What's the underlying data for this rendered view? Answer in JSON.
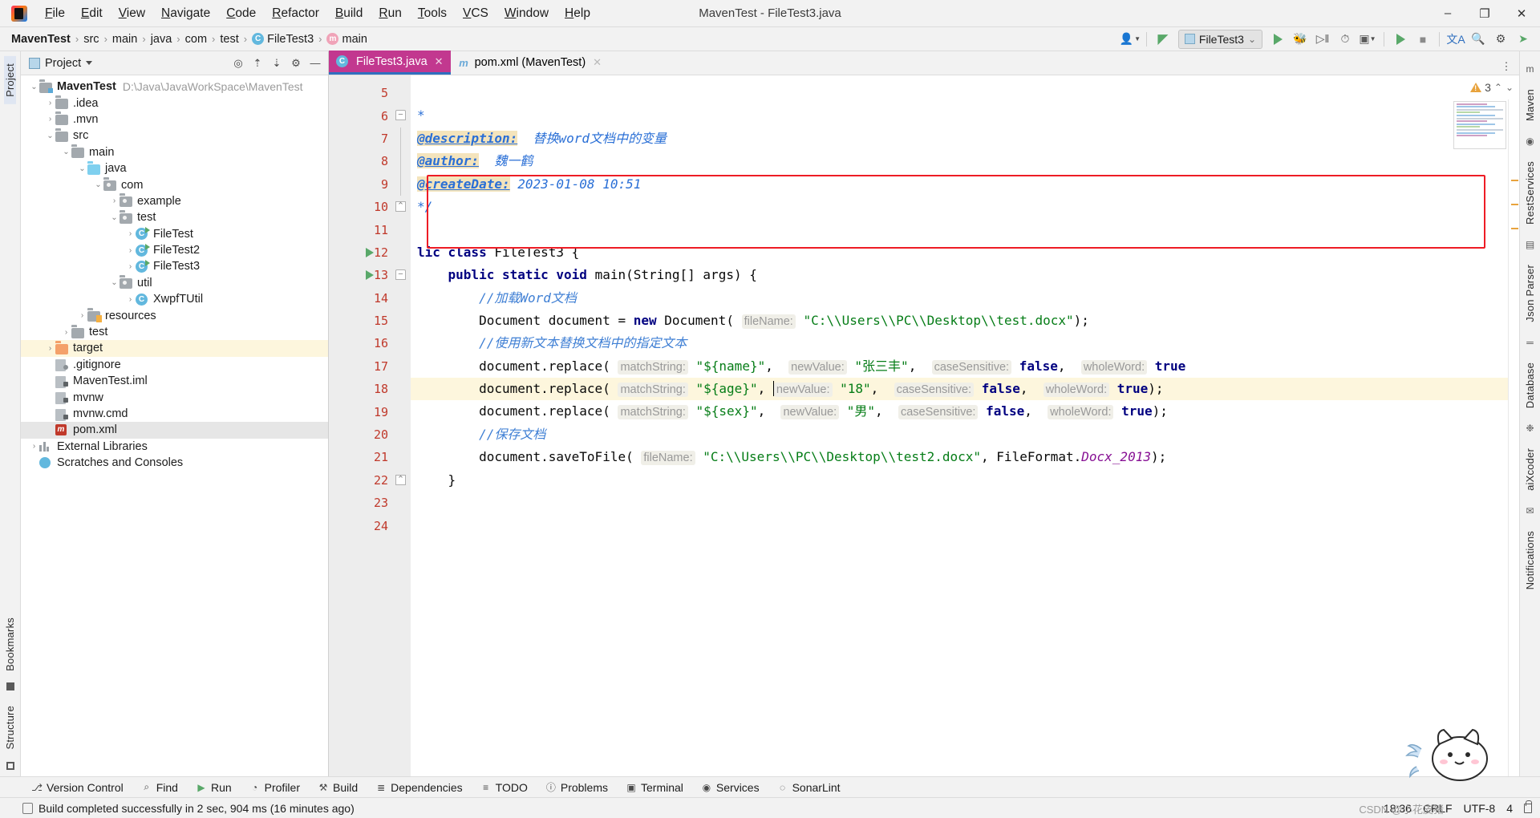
{
  "window": {
    "title": "MavenTest - FileTest3.java",
    "minimize": "–",
    "maximize": "❐",
    "close": "✕"
  },
  "menu": {
    "items": [
      "File",
      "Edit",
      "View",
      "Navigate",
      "Code",
      "Refactor",
      "Build",
      "Run",
      "Tools",
      "VCS",
      "Window",
      "Help"
    ]
  },
  "breadcrumb": {
    "items": [
      {
        "label": "MavenTest",
        "icon": "",
        "bold": true
      },
      {
        "label": "src",
        "icon": "",
        "bold": false
      },
      {
        "label": "main",
        "icon": "",
        "bold": false
      },
      {
        "label": "java",
        "icon": "",
        "bold": false
      },
      {
        "label": "com",
        "icon": "",
        "bold": false
      },
      {
        "label": "test",
        "icon": "",
        "bold": false
      },
      {
        "label": "FileTest3",
        "icon": "class-icon",
        "bold": false
      },
      {
        "label": "main",
        "icon": "method-icon",
        "bold": false
      }
    ],
    "separator": "›"
  },
  "toolbar": {
    "run_config": "FileTest3",
    "search_icon": "search-icon",
    "settings_icon": "gear-icon",
    "translate_icon": "translate-icon",
    "user_icon": "user-icon",
    "hammer_icon": "build-icon",
    "run_icon": "run-icon",
    "debug_icon": "debug-icon",
    "coverage_icon": "coverage-icon",
    "profile_icon": "profile-icon",
    "stop_icon": "stop-icon",
    "updates_icon": "updates-icon"
  },
  "project_panel": {
    "title": "Project",
    "actions": [
      "target-icon",
      "collapse-icon",
      "expand-icon",
      "gear-icon",
      "minimize-icon"
    ],
    "tree": [
      {
        "depth": 0,
        "arrow": "⌄",
        "icon": "module-folder",
        "label": "MavenTest",
        "bold": true,
        "path": "D:\\Java\\JavaWorkSpace\\MavenTest",
        "state": "normal"
      },
      {
        "depth": 1,
        "arrow": "›",
        "icon": "folder",
        "label": ".idea",
        "bold": false,
        "path": "",
        "state": "normal"
      },
      {
        "depth": 1,
        "arrow": "›",
        "icon": "folder",
        "label": ".mvn",
        "bold": false,
        "path": "",
        "state": "normal"
      },
      {
        "depth": 1,
        "arrow": "⌄",
        "icon": "folder",
        "label": "src",
        "bold": false,
        "path": "",
        "state": "normal"
      },
      {
        "depth": 2,
        "arrow": "⌄",
        "icon": "folder",
        "label": "main",
        "bold": false,
        "path": "",
        "state": "normal"
      },
      {
        "depth": 3,
        "arrow": "⌄",
        "icon": "source-folder",
        "label": "java",
        "bold": false,
        "path": "",
        "state": "normal"
      },
      {
        "depth": 4,
        "arrow": "⌄",
        "icon": "package",
        "label": "com",
        "bold": false,
        "path": "",
        "state": "normal"
      },
      {
        "depth": 5,
        "arrow": "›",
        "icon": "package",
        "label": "example",
        "bold": false,
        "path": "",
        "state": "normal"
      },
      {
        "depth": 5,
        "arrow": "⌄",
        "icon": "package",
        "label": "test",
        "bold": false,
        "path": "",
        "state": "normal"
      },
      {
        "depth": 6,
        "arrow": "›",
        "icon": "class-runnable",
        "label": "FileTest",
        "bold": false,
        "path": "",
        "state": "normal"
      },
      {
        "depth": 6,
        "arrow": "›",
        "icon": "class-runnable",
        "label": "FileTest2",
        "bold": false,
        "path": "",
        "state": "normal"
      },
      {
        "depth": 6,
        "arrow": "›",
        "icon": "class-runnable",
        "label": "FileTest3",
        "bold": false,
        "path": "",
        "state": "normal"
      },
      {
        "depth": 5,
        "arrow": "⌄",
        "icon": "package",
        "label": "util",
        "bold": false,
        "path": "",
        "state": "normal"
      },
      {
        "depth": 6,
        "arrow": "›",
        "icon": "class",
        "label": "XwpfTUtil",
        "bold": false,
        "path": "",
        "state": "normal"
      },
      {
        "depth": 3,
        "arrow": "›",
        "icon": "resource-folder",
        "label": "resources",
        "bold": false,
        "path": "",
        "state": "normal"
      },
      {
        "depth": 2,
        "arrow": "›",
        "icon": "folder",
        "label": "test",
        "bold": false,
        "path": "",
        "state": "normal"
      },
      {
        "depth": 1,
        "arrow": "›",
        "icon": "target-folder",
        "label": "target",
        "bold": false,
        "path": "",
        "state": "highlight"
      },
      {
        "depth": 1,
        "arrow": "",
        "icon": "gitignore-file",
        "label": ".gitignore",
        "bold": false,
        "path": "",
        "state": "normal"
      },
      {
        "depth": 1,
        "arrow": "",
        "icon": "iml-file",
        "label": "MavenTest.iml",
        "bold": false,
        "path": "",
        "state": "normal"
      },
      {
        "depth": 1,
        "arrow": "",
        "icon": "file",
        "label": "mvnw",
        "bold": false,
        "path": "",
        "state": "normal"
      },
      {
        "depth": 1,
        "arrow": "",
        "icon": "file",
        "label": "mvnw.cmd",
        "bold": false,
        "path": "",
        "state": "normal"
      },
      {
        "depth": 1,
        "arrow": "",
        "icon": "maven-file",
        "label": "pom.xml",
        "bold": false,
        "path": "",
        "state": "selected"
      },
      {
        "depth": 0,
        "arrow": "›",
        "icon": "library",
        "label": "External Libraries",
        "bold": false,
        "path": "",
        "state": "normal"
      },
      {
        "depth": 0,
        "arrow": "",
        "icon": "scratch",
        "label": "Scratches and Consoles",
        "bold": false,
        "path": "",
        "state": "normal"
      }
    ]
  },
  "left_strip": {
    "items": [
      "Project",
      "Bookmarks",
      "Structure"
    ]
  },
  "right_strip": {
    "items": [
      "Maven",
      "RestServices",
      "Json Parser",
      "Database",
      "aiXcoder",
      "Notifications"
    ]
  },
  "editor": {
    "tabs": [
      {
        "label": "FileTest3.java",
        "icon": "class-icon",
        "active": true
      },
      {
        "label": "pom.xml (MavenTest)",
        "icon": "maven-icon",
        "active": false
      }
    ],
    "warning_count": "3",
    "lines": [
      {
        "no": "5",
        "fold": "",
        "run": false,
        "hl": false,
        "html": ""
      },
      {
        "no": "6",
        "fold": "minus",
        "run": false,
        "hl": false,
        "html": "<span class=\"jd\">*</span>"
      },
      {
        "no": "7",
        "fold": "bar",
        "run": false,
        "hl": false,
        "html": "<span class=\"jdtag\">@description:</span><span class=\"jd\">  替换word文档中的变量</span>"
      },
      {
        "no": "8",
        "fold": "bar",
        "run": false,
        "hl": false,
        "html": "<span class=\"jdtag\">@author:</span><span class=\"jd\">  魏一鹤</span>"
      },
      {
        "no": "9",
        "fold": "bar",
        "run": false,
        "hl": false,
        "html": "<span class=\"jdtag\">@createDate:</span><span class=\"jd\"> 2023-01-08 10:51</span>"
      },
      {
        "no": "10",
        "fold": "end",
        "run": false,
        "hl": false,
        "html": "<span class=\"jd\">*/</span>"
      },
      {
        "no": "11",
        "fold": "",
        "run": false,
        "hl": false,
        "html": ""
      },
      {
        "no": "12",
        "fold": "",
        "run": true,
        "hl": false,
        "html": "<span class=\"kw\">lic class </span><span class=\"plain\">FileTest3 </span><span class=\"plain\">{</span>"
      },
      {
        "no": "13",
        "fold": "minus",
        "run": true,
        "hl": false,
        "html": "    <span class=\"kw\">public static void </span><span class=\"plain\">main(String[] args) {</span>"
      },
      {
        "no": "14",
        "fold": "",
        "run": false,
        "hl": false,
        "html": "        <span class=\"cmt\">//加载Word文档</span>"
      },
      {
        "no": "15",
        "fold": "",
        "run": false,
        "hl": false,
        "html": "        <span class=\"plain\">Document document = </span><span class=\"kw\">new </span><span class=\"plain\">Document(</span> <span class=\"hint\">fileName:</span> <span class=\"str\">\"C:\\\\Users\\\\PC\\\\Desktop\\\\test.docx\"</span><span class=\"plain\">);</span>"
      },
      {
        "no": "16",
        "fold": "",
        "run": false,
        "hl": false,
        "html": "        <span class=\"cmt\">//使用新文本替换文档中的指定文本</span>"
      },
      {
        "no": "17",
        "fold": "",
        "run": false,
        "hl": false,
        "html": "        <span class=\"plain\">document.replace(</span> <span class=\"hint\">matchString:</span> <span class=\"str\">\"${name}\"</span><span class=\"plain\">,</span>  <span class=\"hint\">newValue:</span> <span class=\"str\">\"张三丰\"</span><span class=\"plain\">,</span>  <span class=\"hint\">caseSensitive:</span> <span class=\"kw\">false</span><span class=\"plain\">,</span>  <span class=\"hint\">wholeWord:</span> <span class=\"kw\">true</span>"
      },
      {
        "no": "18",
        "fold": "",
        "run": false,
        "hl": true,
        "html": "        <span class=\"plain\">document.replace(</span> <span class=\"hint\">matchString:</span> <span class=\"str\">\"${age}\"</span><span class=\"plain\">,</span> <span class=\"caret\"></span><span class=\"hint\">newValue:</span> <span class=\"str\">\"18\"</span><span class=\"plain\">,</span>  <span class=\"hint\">caseSensitive:</span> <span class=\"kw\">false</span><span class=\"plain\">,</span>  <span class=\"hint\">wholeWord:</span> <span class=\"kw\">true</span><span class=\"plain\">);</span>"
      },
      {
        "no": "19",
        "fold": "",
        "run": false,
        "hl": false,
        "html": "        <span class=\"plain\">document.replace(</span> <span class=\"hint\">matchString:</span> <span class=\"str\">\"${sex}\"</span><span class=\"plain\">,</span>  <span class=\"hint\">newValue:</span> <span class=\"str\">\"男\"</span><span class=\"plain\">,</span>  <span class=\"hint\">caseSensitive:</span> <span class=\"kw\">false</span><span class=\"plain\">,</span>  <span class=\"hint\">wholeWord:</span> <span class=\"kw\">true</span><span class=\"plain\">);</span>"
      },
      {
        "no": "20",
        "fold": "",
        "run": false,
        "hl": false,
        "html": "        <span class=\"cmt\">//保存文档</span>"
      },
      {
        "no": "21",
        "fold": "",
        "run": false,
        "hl": false,
        "html": "        <span class=\"plain\">document.saveToFile(</span> <span class=\"hint\">fileName:</span> <span class=\"str\">\"C:\\\\Users\\\\PC\\\\Desktop\\\\test2.docx\"</span><span class=\"plain\">, FileFormat.</span><span class=\"stc\">Docx_2013</span><span class=\"plain\">);</span>"
      },
      {
        "no": "22",
        "fold": "end",
        "run": false,
        "hl": false,
        "html": "    <span class=\"plain\">}</span>"
      },
      {
        "no": "23",
        "fold": "",
        "run": false,
        "hl": false,
        "html": ""
      },
      {
        "no": "24",
        "fold": "",
        "run": false,
        "hl": false,
        "html": ""
      }
    ]
  },
  "bottom_tools": [
    {
      "label": "Version Control",
      "icon": "branch-icon"
    },
    {
      "label": "Find",
      "icon": "search-icon"
    },
    {
      "label": "Run",
      "icon": "run-icon"
    },
    {
      "label": "Profiler",
      "icon": "profiler-icon"
    },
    {
      "label": "Build",
      "icon": "hammer-icon"
    },
    {
      "label": "Dependencies",
      "icon": "dependencies-icon"
    },
    {
      "label": "TODO",
      "icon": "todo-icon"
    },
    {
      "label": "Problems",
      "icon": "problems-icon"
    },
    {
      "label": "Terminal",
      "icon": "terminal-icon"
    },
    {
      "label": "Services",
      "icon": "services-icon"
    },
    {
      "label": "SonarLint",
      "icon": "sonarlint-icon"
    }
  ],
  "status_bar": {
    "message": "Build completed successfully in 2 sec, 904 ms (16 minutes ago)",
    "time": "18:36",
    "line_sep": "CRLF",
    "encoding": "UTF-8",
    "indent": "4",
    "lock_icon": "lock-icon"
  },
  "watermark": "CSDN @小花皮猪"
}
